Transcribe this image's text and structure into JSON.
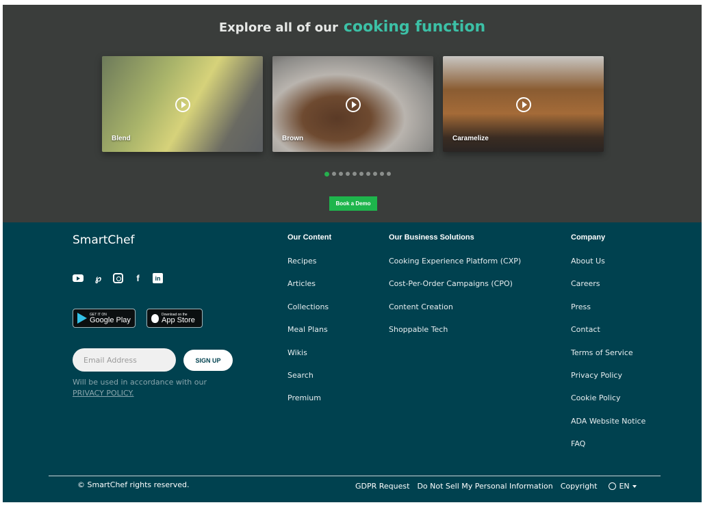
{
  "explore": {
    "title_prefix": "Explore all of our",
    "title_accent": "cooking function",
    "cards": [
      {
        "label": "Blend",
        "icon": "play-icon"
      },
      {
        "label": "Brown",
        "icon": "play-icon"
      },
      {
        "label": "Caramelize",
        "icon": "play-icon"
      }
    ],
    "carousel": {
      "total_dots": 10,
      "active_index": 0
    },
    "book_demo_label": "Book a Demo",
    "colors": {
      "background": "#3a3d3b",
      "accent": "#3cc0a6",
      "button": "#1eb54c"
    }
  },
  "footer": {
    "brand": "SmartChef",
    "social_icons": [
      "youtube-icon",
      "pinterest-icon",
      "instagram-icon",
      "facebook-icon",
      "linkedin-icon"
    ],
    "stores": {
      "google": {
        "small": "GET IT ON",
        "big": "Google Play"
      },
      "apple": {
        "small": "Download on the",
        "big": "App Store"
      }
    },
    "newsletter": {
      "placeholder": "Email Address",
      "button_label": "SIGN UP",
      "note": "Will be used in accordance with our",
      "link": "PRIVACY POLICY."
    },
    "columns": {
      "content": {
        "heading": "Our Content",
        "items": [
          "Recipes",
          "Articles",
          "Collections",
          "Meal Plans",
          "Wikis",
          "Search",
          "Premium"
        ]
      },
      "business": {
        "heading": "Our Business Solutions",
        "items": [
          "Cooking Experience Platform (CXP)",
          "Cost-Per-Order Campaigns (CPO)",
          "Content Creation",
          "Shoppable Tech"
        ]
      },
      "company": {
        "heading": "Company",
        "items": [
          "About Us",
          "Careers",
          "Press",
          "Contact",
          "Terms of Service",
          "Privacy Policy",
          "Cookie Policy",
          "ADA Website Notice",
          "FAQ"
        ]
      }
    },
    "bottom": {
      "copyright": "© SmartChef rights reserved.",
      "links": [
        "GDPR Request",
        "Do Not Sell My Personal Information",
        "Copyright"
      ],
      "language": "EN"
    },
    "colors": {
      "background": "#00414f"
    }
  }
}
